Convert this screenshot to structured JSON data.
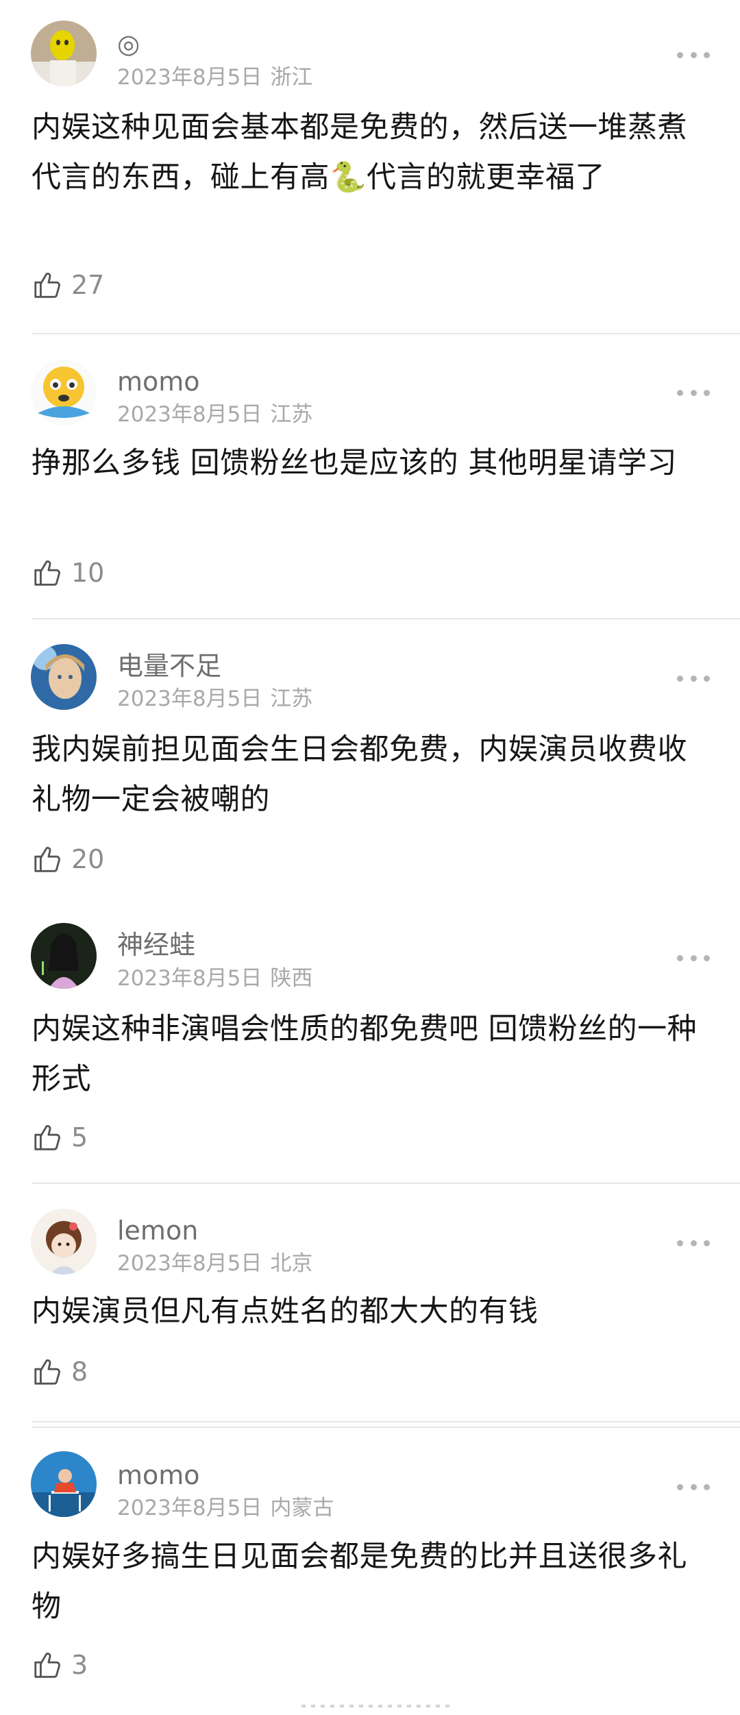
{
  "comments": [
    {
      "username": "◎",
      "date": "2023年8月5日",
      "location": "浙江",
      "text": "内娱这种见面会基本都是免费的，然后送一堆蒸煮代言的东西，碰上有高🐍代言的就更幸福了",
      "likes": "27",
      "avatar_colors": {
        "bg": "#c9b8a0",
        "accent": "#e8d800"
      }
    },
    {
      "username": "momo",
      "date": "2023年8月5日",
      "location": "江苏",
      "text": "挣那么多钱 回馈粉丝也是应该的 其他明星请学习",
      "likes": "10",
      "avatar_colors": {
        "bg": "#f7f7f7",
        "accent": "#f7c531"
      }
    },
    {
      "username": "电量不足",
      "date": "2023年8月5日",
      "location": "江苏",
      "text": "我内娱前担见面会生日会都免费，内娱演员收费收礼物一定会被嘲的",
      "likes": "20",
      "avatar_colors": {
        "bg": "#2f6aa6",
        "accent": "#e8c9a8"
      }
    },
    {
      "username": "神经蛙",
      "date": "2023年8月5日",
      "location": "陕西",
      "text": "内娱这种非演唱会性质的都免费吧 回馈粉丝的一种形式",
      "likes": "5",
      "avatar_colors": {
        "bg": "#1f2a1e",
        "accent": "#d9a8d8"
      }
    },
    {
      "username": "lemon",
      "date": "2023年8月5日",
      "location": "北京",
      "text": "内娱演员但凡有点姓名的都大大的有钱",
      "likes": "8",
      "avatar_colors": {
        "bg": "#f3eee8",
        "accent": "#7a4a2e"
      }
    },
    {
      "username": "momo",
      "date": "2023年8月5日",
      "location": "内蒙古",
      "text": "内娱好多搞生日见面会都是免费的比并且送很多礼物",
      "likes": "3",
      "avatar_colors": {
        "bg": "#2d86c9",
        "accent": "#e84a2e"
      }
    }
  ],
  "icons": {
    "like": "thumbs-up-outline-icon",
    "more": "more-horizontal-icon"
  },
  "colors": {
    "username": "#6e6e6e",
    "meta": "#a8a8a8",
    "text": "#161616",
    "divider": "#e6e6e6"
  }
}
